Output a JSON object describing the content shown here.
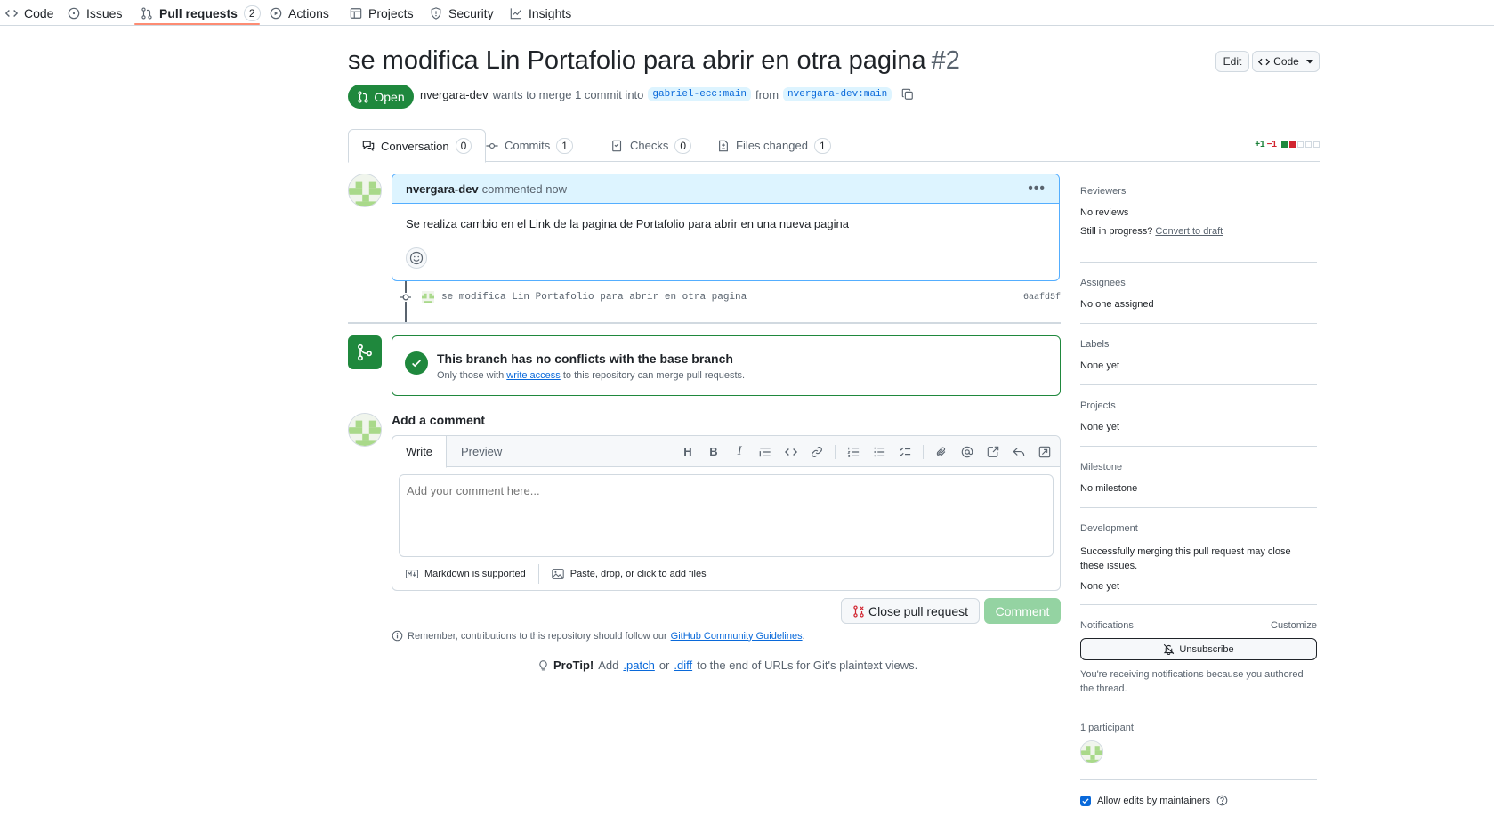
{
  "repo_nav": {
    "items": [
      {
        "label": "Code",
        "icon": "code-icon"
      },
      {
        "label": "Issues",
        "icon": "issue-icon"
      },
      {
        "label": "Pull requests",
        "icon": "pull-request-icon",
        "count": "2",
        "selected": true
      },
      {
        "label": "Actions",
        "icon": "play-icon"
      },
      {
        "label": "Projects",
        "icon": "table-icon"
      },
      {
        "label": "Security",
        "icon": "shield-icon"
      },
      {
        "label": "Insights",
        "icon": "graph-icon"
      }
    ]
  },
  "header": {
    "title": "se modifica Lin Portafolio para abrir en otra pagina",
    "number": "#2",
    "edit_label": "Edit",
    "code_label": "Code",
    "state": "Open",
    "author": "nvergara-dev",
    "merge_text_1": "wants to merge 1 commit into",
    "base_branch": "gabriel-ecc:main",
    "merge_text_2": "from",
    "head_branch": "nvergara-dev:main"
  },
  "tabs": [
    {
      "label": "Conversation",
      "count": "0",
      "icon": "comment-discussion-icon"
    },
    {
      "label": "Commits",
      "count": "1",
      "icon": "commit-icon"
    },
    {
      "label": "Checks",
      "count": "0",
      "icon": "checklist-icon"
    },
    {
      "label": "Files changed",
      "count": "1",
      "icon": "file-diff-icon"
    }
  ],
  "diffstat": {
    "additions": "+1",
    "deletions": "−1"
  },
  "comment": {
    "author": "nvergara-dev",
    "meta": "commented now",
    "body": "Se realiza cambio en el Link de la pagina de Portafolio para abrir en una nueva pagina"
  },
  "commit": {
    "message": "se modifica Lin Portafolio para abrir en otra pagina",
    "sha": "6aafd5f"
  },
  "merge_box": {
    "title": "This branch has no conflicts with the base branch",
    "sub_1": "Only those with",
    "sub_link": "write access",
    "sub_2": "to this repository can merge pull requests."
  },
  "new_comment": {
    "heading": "Add a comment",
    "write_tab": "Write",
    "preview_tab": "Preview",
    "placeholder": "Add your comment here...",
    "markdown_note": "Markdown is supported",
    "attach_note": "Paste, drop, or click to add files",
    "close_label": "Close pull request",
    "comment_label": "Comment"
  },
  "remember": {
    "text": "Remember, contributions to this repository should follow our",
    "link": "GitHub Community Guidelines",
    "end": "."
  },
  "protip": {
    "label": "ProTip!",
    "t1": "Add",
    "patch": ".patch",
    "t2": "or",
    "diff": ".diff",
    "t3": "to the end of URLs for Git's plaintext views."
  },
  "sidebar": {
    "reviewers": {
      "heading": "Reviewers",
      "value": "No reviews",
      "progress_text": "Still in progress?",
      "progress_link": "Convert to draft"
    },
    "assignees": {
      "heading": "Assignees",
      "value": "No one assigned"
    },
    "labels": {
      "heading": "Labels",
      "value": "None yet"
    },
    "projects": {
      "heading": "Projects",
      "value": "None yet"
    },
    "milestone": {
      "heading": "Milestone",
      "value": "No milestone"
    },
    "development": {
      "heading": "Development",
      "desc": "Successfully merging this pull request may close these issues.",
      "value": "None yet"
    },
    "notifications": {
      "heading": "Notifications",
      "customize": "Customize",
      "button": "Unsubscribe",
      "note": "You're receiving notifications because you authored the thread."
    },
    "participants": {
      "heading": "1 participant"
    },
    "allow_edits": "Allow edits by maintainers"
  },
  "colors": {
    "green": "#1f883d",
    "blue": "#0969da",
    "border": "#d1d9e0",
    "muted": "#59636e",
    "red": "#d1242f"
  }
}
